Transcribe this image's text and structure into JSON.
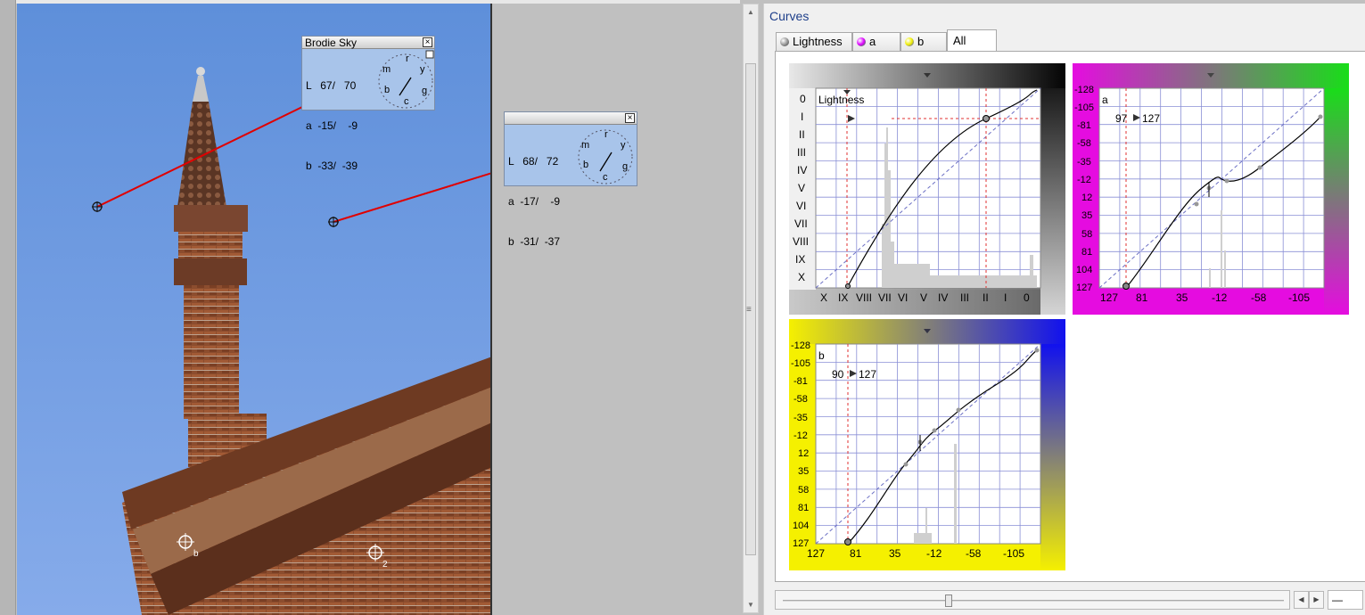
{
  "colors": {
    "sky": "#6f9be0",
    "brick": "#8a4a2c",
    "panel_bg": "#a8c4ea",
    "accent_magenta": "#e50ce0",
    "accent_green": "#22dd22",
    "accent_yellow": "#f5f000",
    "accent_blue": "#1111ee",
    "title_text": "#1e3f8a",
    "marker_red": "#e00000"
  },
  "sample1": {
    "title": "Brodie Sky",
    "close_icon": "×",
    "rows": [
      "L   67/   70",
      "a  -15/    -9",
      "b  -33/  -39"
    ],
    "dial": {
      "labels": {
        "r": "r",
        "y": "y",
        "g": "g",
        "c": "c",
        "b": "b",
        "m": "m"
      }
    }
  },
  "sample2": {
    "title": "",
    "close_icon": "×",
    "rows": [
      "L   68/   72",
      "a  -17/    -9",
      "b  -31/  -37"
    ],
    "dial": {
      "labels": {
        "r": "r",
        "y": "y",
        "g": "g",
        "c": "c",
        "b": "b",
        "m": "m"
      }
    }
  },
  "photo_markers": {
    "corner_label": "b",
    "corner_label2": "2"
  },
  "curves": {
    "title": "Curves",
    "tabs": [
      {
        "label": "Lightness",
        "icon": "lightness-ball-icon"
      },
      {
        "label": "a",
        "icon": "a-ball-icon"
      },
      {
        "label": "b",
        "icon": "b-ball-icon"
      },
      {
        "label": "All",
        "icon": ""
      }
    ],
    "active_tab": "All",
    "lightness": {
      "label": "Lightness",
      "y_ticks": [
        "0",
        "I",
        "II",
        "III",
        "IV",
        "V",
        "VI",
        "VII",
        "VIII",
        "IX",
        "X"
      ],
      "x_ticks": [
        "X",
        "IX",
        "VIII",
        "VII",
        "VI",
        "V",
        "IV",
        "III",
        "II",
        "I",
        "0"
      ]
    },
    "a_channel": {
      "label": "a",
      "readout_in": "97",
      "readout_out": "127",
      "y_ticks": [
        "-128",
        "-105",
        "-81",
        "-58",
        "-35",
        "-12",
        "12",
        "35",
        "58",
        "81",
        "104",
        "127"
      ],
      "x_ticks": [
        "127",
        "81",
        "35",
        "-12",
        "-58",
        "-105"
      ]
    },
    "b_channel": {
      "label": "b",
      "readout_in": "90",
      "readout_out": "127",
      "y_ticks": [
        "-128",
        "-105",
        "-81",
        "-58",
        "-35",
        "-12",
        "12",
        "35",
        "58",
        "81",
        "104",
        "127"
      ],
      "x_ticks": [
        "127",
        "81",
        "35",
        "-12",
        "-58",
        "-105"
      ]
    },
    "zoom_value": "—"
  }
}
